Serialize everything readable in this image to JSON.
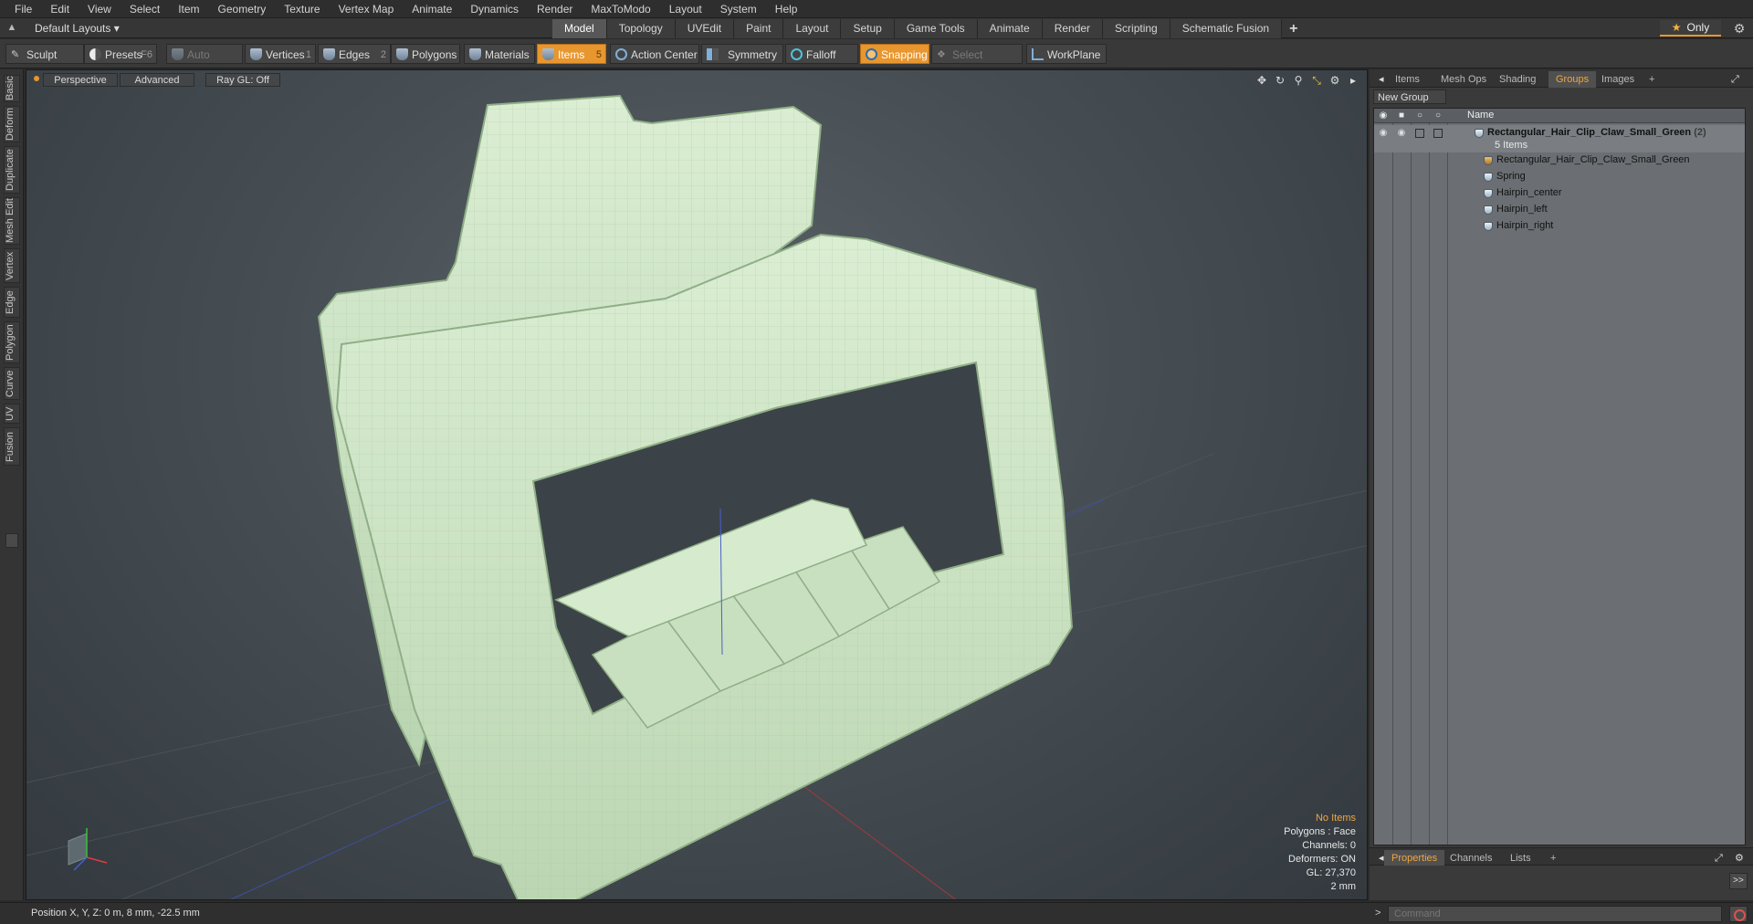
{
  "menu": [
    "File",
    "Edit",
    "View",
    "Select",
    "Item",
    "Geometry",
    "Texture",
    "Vertex Map",
    "Animate",
    "Dynamics",
    "Render",
    "MaxToModo",
    "Layout",
    "System",
    "Help"
  ],
  "layout": {
    "dropdown": "Default Layouts",
    "tabs": [
      "Model",
      "Topology",
      "UVEdit",
      "Paint",
      "Layout",
      "Setup",
      "Game Tools",
      "Animate",
      "Render",
      "Scripting",
      "Schematic Fusion"
    ],
    "active_tab": "Model",
    "only_label": "Only"
  },
  "toolbar": {
    "sculpt": "Sculpt",
    "presets": "Presets",
    "presets_key": "F6",
    "auto_select": "Auto Select",
    "vertices": "Vertices",
    "vertices_num": "1",
    "edges": "Edges",
    "edges_num": "2",
    "polygons": "Polygons",
    "materials": "Materials",
    "items": "Items",
    "items_num": "5",
    "action_center": "Action Center",
    "symmetry": "Symmetry",
    "falloff": "Falloff",
    "snapping": "Snapping",
    "select_through": "Select Through",
    "workplane": "WorkPlane"
  },
  "left_tabs": [
    "Basic",
    "Deform",
    "Duplicate",
    "Mesh Edit",
    "Vertex",
    "Edge",
    "Polygon",
    "Curve",
    "UV",
    "Fusion"
  ],
  "viewport": {
    "view": "Perspective",
    "shading": "Advanced",
    "raygl": "Ray GL: Off",
    "info": {
      "selection": "No Items",
      "polygons": "Polygons : Face",
      "channels": "Channels: 0",
      "deformers": "Deformers: ON",
      "gl": "GL: 27,370",
      "scale": "2 mm"
    }
  },
  "status": {
    "position": "Position X, Y, Z:  0 m, 8 mm, -22.5 mm"
  },
  "right_panel": {
    "tabs": [
      "Items",
      "Mesh Ops",
      "Shading",
      "Groups",
      "Images",
      "+"
    ],
    "active_tab": "Groups",
    "new_group": "New Group",
    "name_header": "Name",
    "group": {
      "name": "Rectangular_Hair_Clip_Claw_Small_Green",
      "count": "(2)",
      "sub": "5 Items"
    },
    "children": [
      "Rectangular_Hair_Clip_Claw_Small_Green",
      "Spring",
      "Hairpin_center",
      "Hairpin_left",
      "Hairpin_right"
    ],
    "bottom_tabs": [
      "Properties",
      "Channels",
      "Lists",
      "+"
    ],
    "active_bottom_tab": "Properties",
    "props_arrow": ">>",
    "command_placeholder": "Command"
  },
  "colors": {
    "accent": "#e8962e",
    "model_fill": "#cfe6c6",
    "viewport_bg": "#464e54"
  }
}
